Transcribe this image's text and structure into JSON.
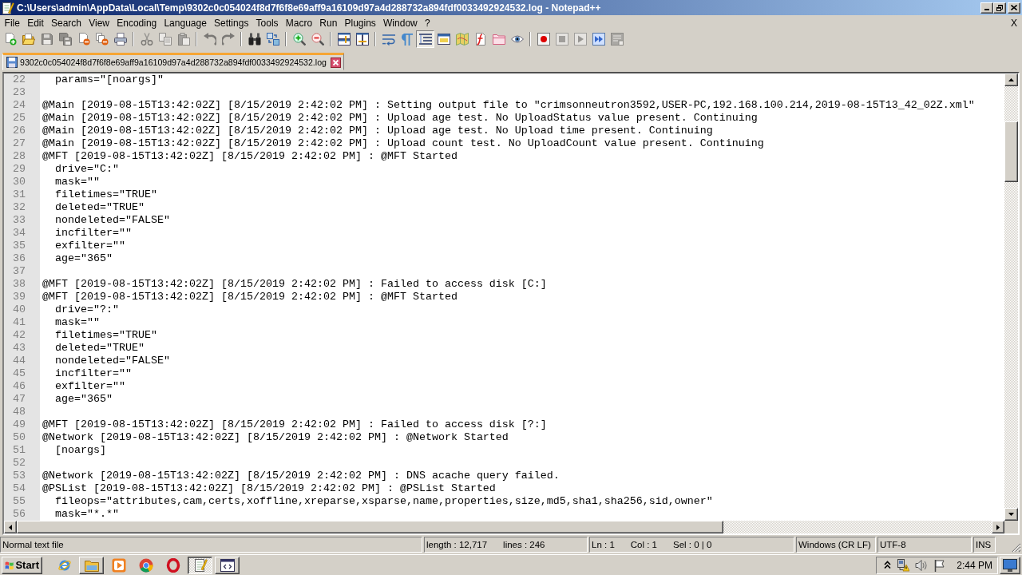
{
  "window": {
    "title": "C:\\Users\\admin\\AppData\\Local\\Temp\\9302c0c054024f8d7f6f8e69aff9a16109d97a4d288732a894fdf0033492924532.log - Notepad++"
  },
  "menu_bar": {
    "items": [
      "File",
      "Edit",
      "Search",
      "View",
      "Encoding",
      "Language",
      "Settings",
      "Tools",
      "Macro",
      "Run",
      "Plugins",
      "Window",
      "?"
    ],
    "close_button": "X"
  },
  "toolbar": {
    "buttons": [
      {
        "on": false,
        "disabled": false
      },
      {
        "on": false,
        "disabled": false
      },
      {
        "on": false,
        "disabled": true
      },
      {
        "on": false,
        "disabled": true
      },
      {
        "on": false,
        "disabled": false
      },
      {
        "on": false,
        "disabled": false
      },
      {
        "on": false,
        "disabled": false
      },
      {
        "on": false,
        "disabled": true
      },
      {
        "on": false,
        "disabled": true
      },
      {
        "on": false,
        "disabled": true
      },
      {
        "on": false,
        "disabled": true
      },
      {
        "on": false,
        "disabled": true
      },
      {
        "on": false,
        "disabled": false
      },
      {
        "on": false,
        "disabled": false
      },
      {
        "on": false,
        "disabled": false
      },
      {
        "on": false,
        "disabled": false
      },
      {
        "on": false,
        "disabled": false
      },
      {
        "on": false,
        "disabled": false
      },
      {
        "on": false,
        "disabled": false
      },
      {
        "on": false,
        "disabled": false
      },
      {
        "on": true,
        "disabled": false
      },
      {
        "on": false,
        "disabled": false
      },
      {
        "on": false,
        "disabled": false
      },
      {
        "on": false,
        "disabled": false
      },
      {
        "on": false,
        "disabled": false
      },
      {
        "on": false,
        "disabled": false
      },
      {
        "on": false,
        "disabled": false
      },
      {
        "on": false,
        "disabled": true
      },
      {
        "on": false,
        "disabled": true
      },
      {
        "on": false,
        "disabled": false
      },
      {
        "on": false,
        "disabled": true
      }
    ]
  },
  "tabs": [
    {
      "label": "9302c0c054024f8d7f6f8e69aff9a16109d97a4d288732a894fdf0033492924532.log",
      "selected": true
    }
  ],
  "editor": {
    "lines": [
      {
        "number": "22",
        "text": "  params=\"[noargs]\""
      },
      {
        "number": "23"
      },
      {
        "number": "24",
        "text": "@Main [2019-08-15T13:42:02Z] [8/15/2019 2:42:02 PM] : Setting output file to \"crimsonneutron3592,USER-PC,192.168.100.214,2019-08-15T13_42_02Z.xml\""
      },
      {
        "number": "25",
        "text": "@Main [2019-08-15T13:42:02Z] [8/15/2019 2:42:02 PM] : Upload age test. No UploadStatus value present. Continuing"
      },
      {
        "number": "26",
        "text": "@Main [2019-08-15T13:42:02Z] [8/15/2019 2:42:02 PM] : Upload age test. No Upload time present. Continuing"
      },
      {
        "number": "27",
        "text": "@Main [2019-08-15T13:42:02Z] [8/15/2019 2:42:02 PM] : Upload count test. No UploadCount value present. Continuing"
      },
      {
        "number": "28",
        "text": "@MFT [2019-08-15T13:42:02Z] [8/15/2019 2:42:02 PM] : @MFT Started"
      },
      {
        "number": "29",
        "text": "  drive=\"C:\""
      },
      {
        "number": "30",
        "text": "  mask=\"\""
      },
      {
        "number": "31",
        "text": "  filetimes=\"TRUE\""
      },
      {
        "number": "32",
        "text": "  deleted=\"TRUE\""
      },
      {
        "number": "33",
        "text": "  nondeleted=\"FALSE\""
      },
      {
        "number": "34",
        "text": "  incfilter=\"\""
      },
      {
        "number": "35",
        "text": "  exfilter=\"\""
      },
      {
        "number": "36",
        "text": "  age=\"365\""
      },
      {
        "number": "37"
      },
      {
        "number": "38",
        "text": "@MFT [2019-08-15T13:42:02Z] [8/15/2019 2:42:02 PM] : Failed to access disk [C:]"
      },
      {
        "number": "39",
        "text": "@MFT [2019-08-15T13:42:02Z] [8/15/2019 2:42:02 PM] : @MFT Started"
      },
      {
        "number": "40",
        "text": "  drive=\"?:\""
      },
      {
        "number": "41",
        "text": "  mask=\"\""
      },
      {
        "number": "42",
        "text": "  filetimes=\"TRUE\""
      },
      {
        "number": "43",
        "text": "  deleted=\"TRUE\""
      },
      {
        "number": "44",
        "text": "  nondeleted=\"FALSE\""
      },
      {
        "number": "45",
        "text": "  incfilter=\"\""
      },
      {
        "number": "46",
        "text": "  exfilter=\"\""
      },
      {
        "number": "47",
        "text": "  age=\"365\""
      },
      {
        "number": "48"
      },
      {
        "number": "49",
        "text": "@MFT [2019-08-15T13:42:02Z] [8/15/2019 2:42:02 PM] : Failed to access disk [?:]"
      },
      {
        "number": "50",
        "text": "@Network [2019-08-15T13:42:02Z] [8/15/2019 2:42:02 PM] : @Network Started"
      },
      {
        "number": "51",
        "text": "  [noargs]"
      },
      {
        "number": "52"
      },
      {
        "number": "53",
        "text": "@Network [2019-08-15T13:42:02Z] [8/15/2019 2:42:02 PM] : DNS acache query failed."
      },
      {
        "number": "54",
        "text": "@PSList [2019-08-15T13:42:02Z] [8/15/2019 2:42:02 PM] : @PSList Started"
      },
      {
        "number": "55",
        "text": "  fileops=\"attributes,cam,certs,xoffline,xreparse,xsparse,name,properties,size,md5,sha1,sha256,sid,owner\""
      },
      {
        "number": "56",
        "text": "  mask=\"*.*\""
      }
    ]
  },
  "status_bar": {
    "panels": [
      {
        "items": [
          "Normal text file"
        ]
      },
      {
        "items": [
          "length : 12,717",
          "lines : 246"
        ]
      },
      {
        "items": [
          "Ln : 1",
          "Col : 1",
          "Sel : 0 | 0"
        ]
      },
      {
        "items": [
          "Windows (CR LF)"
        ]
      },
      {
        "items": [
          "UTF-8"
        ]
      },
      {
        "items": [
          "INS"
        ]
      }
    ]
  },
  "taskbar": {
    "start_label": "Start",
    "apps": [
      {
        "running": false,
        "active": false
      },
      {
        "running": true,
        "active": false
      },
      {
        "running": false,
        "active": false
      },
      {
        "running": false,
        "active": false
      },
      {
        "running": false,
        "active": false
      },
      {
        "running": true,
        "active": true
      },
      {
        "running": true,
        "active": false
      }
    ],
    "clock": "2:44 PM"
  }
}
